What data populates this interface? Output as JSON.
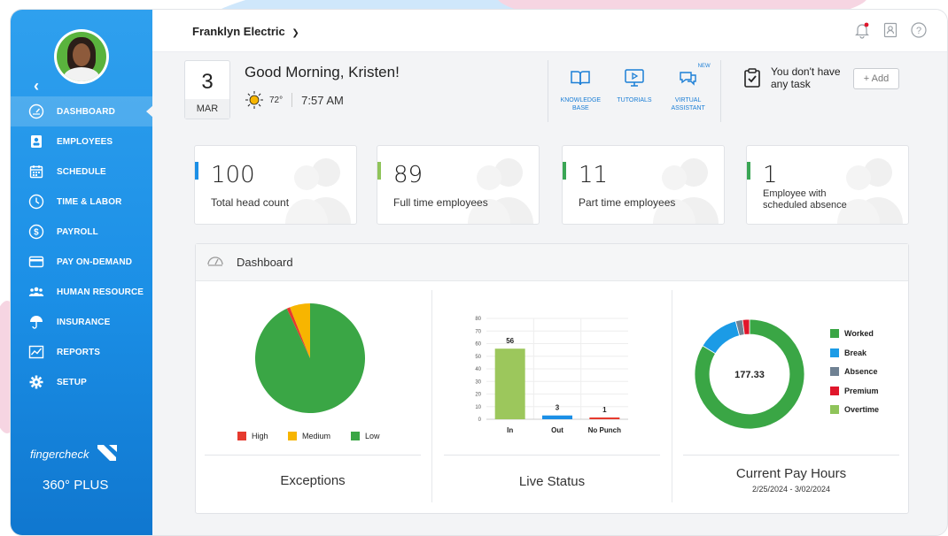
{
  "sidebar": {
    "items": [
      {
        "label": "DASHBOARD",
        "icon": "gauge-icon",
        "active": true
      },
      {
        "label": "EMPLOYEES",
        "icon": "id-card-icon"
      },
      {
        "label": "SCHEDULE",
        "icon": "calendar-icon"
      },
      {
        "label": "TIME & LABOR",
        "icon": "clock-icon"
      },
      {
        "label": "PAYROLL",
        "icon": "dollar-icon"
      },
      {
        "label": "PAY ON-DEMAND",
        "icon": "card-icon"
      },
      {
        "label": "HUMAN RESOURCE",
        "icon": "people-icon"
      },
      {
        "label": "INSURANCE",
        "icon": "umbrella-icon"
      },
      {
        "label": "REPORTS",
        "icon": "chart-icon"
      },
      {
        "label": "SETUP",
        "icon": "gear-icon"
      }
    ],
    "brand": "fingercheck",
    "edition": "360° PLUS"
  },
  "header": {
    "company": "Franklyn Electric"
  },
  "today": {
    "day": "3",
    "month": "MAR",
    "greeting": "Good Morning, Kristen!",
    "temperature": "72°",
    "time": "7:57 AM"
  },
  "shortcuts": [
    {
      "label": "KNOWLEDGE BASE",
      "icon": "book-icon"
    },
    {
      "label": "TUTORIALS",
      "icon": "video-icon"
    },
    {
      "label": "VIRTUAL ASSISTANT",
      "icon": "chat-icon",
      "badge": "NEW"
    }
  ],
  "task": {
    "text": "You don't have any task",
    "add_label": "+ Add"
  },
  "stats": [
    {
      "value": "100",
      "label": "Total head count",
      "color": "#1b8fe6"
    },
    {
      "value": "89",
      "label": "Full time employees",
      "color": "#8fc45a"
    },
    {
      "value": "11",
      "label": "Part time employees",
      "color": "#3aa655"
    },
    {
      "value": "1",
      "label": "Employee with scheduled absence",
      "color": "#3aa655"
    }
  ],
  "panel": {
    "title": "Dashboard"
  },
  "chart_data": [
    {
      "type": "pie",
      "title": "Exceptions",
      "labels": [
        "High",
        "Medium",
        "Low"
      ],
      "values": [
        1,
        6,
        93
      ],
      "colors": [
        "#e63a2e",
        "#f7b500",
        "#3aa645"
      ]
    },
    {
      "type": "bar",
      "title": "Live Status",
      "categories": [
        "In",
        "Out",
        "No Punch"
      ],
      "values": [
        56,
        3,
        1
      ],
      "data_labels": [
        "56",
        "3",
        "1"
      ],
      "colors": [
        "#9cc75c",
        "#1b8fe6",
        "#e63a2e"
      ],
      "ylim": [
        0,
        80
      ],
      "yticks": [
        "0",
        "10",
        "20",
        "30",
        "40",
        "50",
        "60",
        "70",
        "80"
      ]
    },
    {
      "type": "donut",
      "title": "Current Pay Hours",
      "subtitle": "2/25/2024 - 3/02/2024",
      "center_label": "177.33",
      "labels": [
        "Worked",
        "Break",
        "Absence",
        "Premium",
        "Overtime"
      ],
      "values": [
        82,
        12,
        2,
        2,
        0
      ],
      "colors": [
        "#3aa645",
        "#1b9be6",
        "#6f8193",
        "#e0162b",
        "#8fc45a"
      ]
    }
  ]
}
